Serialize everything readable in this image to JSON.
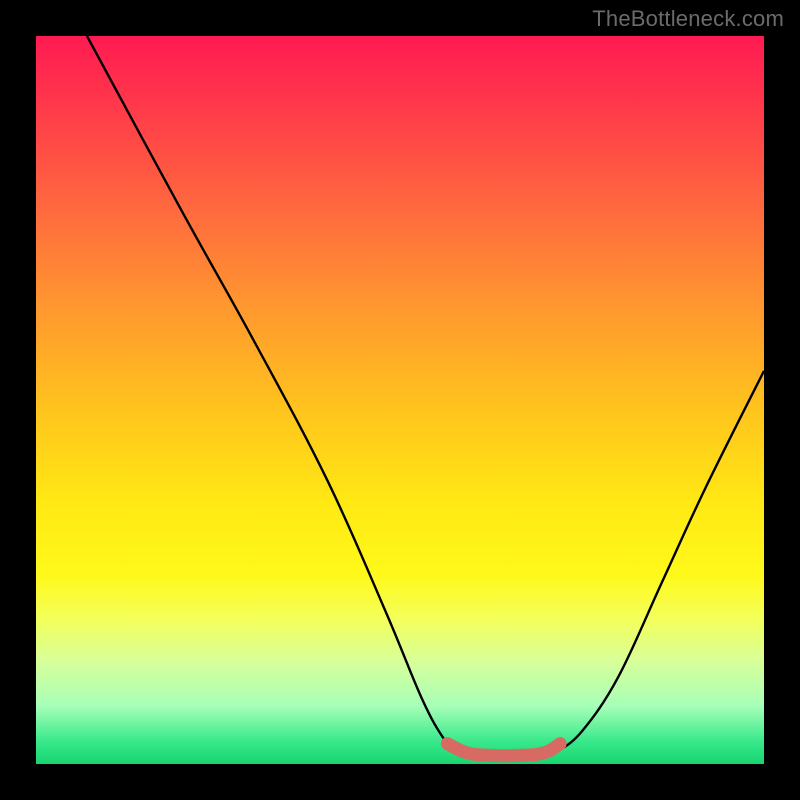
{
  "watermark": {
    "text": "TheBottleneck.com"
  },
  "colors": {
    "curve_stroke": "#000000",
    "band_stroke": "#d86a64",
    "band_fill": "#d86a64"
  },
  "chart_data": {
    "type": "line",
    "title": "",
    "xlabel": "",
    "ylabel": "",
    "xlim": [
      0,
      100
    ],
    "ylim": [
      0,
      100
    ],
    "grid": false,
    "legend": false,
    "series": [
      {
        "name": "left-branch",
        "x": [
          7,
          20,
          30,
          40,
          48,
          53,
          56,
          58
        ],
        "y": [
          100,
          76,
          58,
          39,
          21,
          9,
          3.5,
          1.6
        ]
      },
      {
        "name": "valley-floor",
        "x": [
          58,
          62,
          67,
          71.5
        ],
        "y": [
          1.6,
          1.2,
          1.2,
          1.6
        ]
      },
      {
        "name": "right-branch",
        "x": [
          71.5,
          75,
          80,
          86,
          92,
          100
        ],
        "y": [
          1.6,
          4.5,
          12,
          25,
          38,
          54
        ]
      }
    ],
    "highlight_band": {
      "description": "thick muted-red short segment at valley floor",
      "x": [
        56.5,
        59,
        62,
        67,
        70,
        72
      ],
      "y": [
        2.8,
        1.6,
        1.2,
        1.2,
        1.6,
        2.8
      ]
    }
  }
}
